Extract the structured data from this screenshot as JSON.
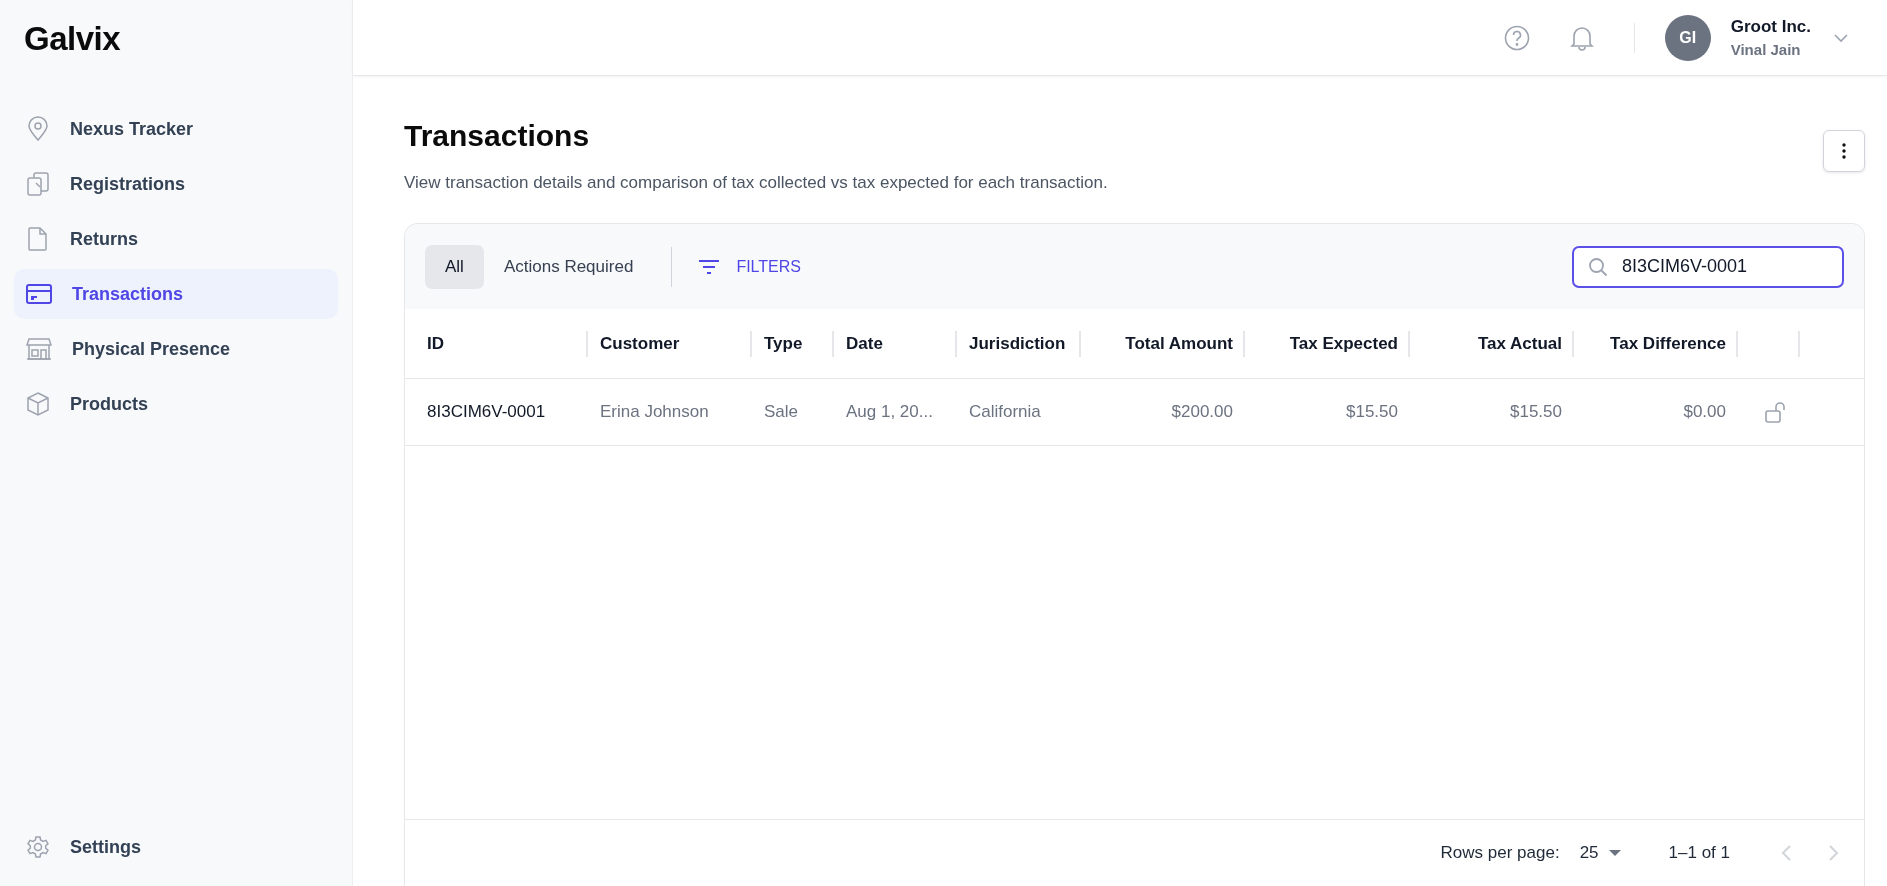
{
  "brand": "Galvix",
  "sidebar": {
    "items": [
      {
        "label": "Nexus Tracker",
        "selected": false
      },
      {
        "label": "Registrations",
        "selected": false
      },
      {
        "label": "Returns",
        "selected": false
      },
      {
        "label": "Transactions",
        "selected": true
      },
      {
        "label": "Physical Presence",
        "selected": false
      },
      {
        "label": "Products",
        "selected": false
      }
    ],
    "footer_item": {
      "label": "Settings",
      "selected": false
    }
  },
  "header": {
    "avatar_initials": "GI",
    "company": "Groot Inc.",
    "user": "Vinal Jain"
  },
  "page": {
    "title": "Transactions",
    "subtitle": "View transaction details and comparison of tax collected vs tax expected for each transaction."
  },
  "toolbar": {
    "tabs": [
      {
        "label": "All",
        "selected": true
      },
      {
        "label": "Actions Required",
        "selected": false
      }
    ],
    "filters_label": "FILTERS",
    "search": {
      "value": "8I3CIM6V-0001"
    }
  },
  "table": {
    "columns": [
      "ID",
      "Customer",
      "Type",
      "Date",
      "Jurisdiction",
      "Total Amount",
      "Tax Expected",
      "Tax Actual",
      "Tax Difference"
    ],
    "rows": [
      {
        "cells": [
          "8I3CIM6V-0001",
          "Erina Johnson",
          "Sale",
          "Aug 1, 20...",
          "California",
          "$200.00",
          "$15.50",
          "$15.50",
          "$0.00"
        ],
        "locked": false
      }
    ]
  },
  "pagination": {
    "rows_per_page_label": "Rows per page:",
    "rows_per_page": "25",
    "range": "1–1 of 1",
    "prev_disabled": true,
    "next_disabled": true
  }
}
